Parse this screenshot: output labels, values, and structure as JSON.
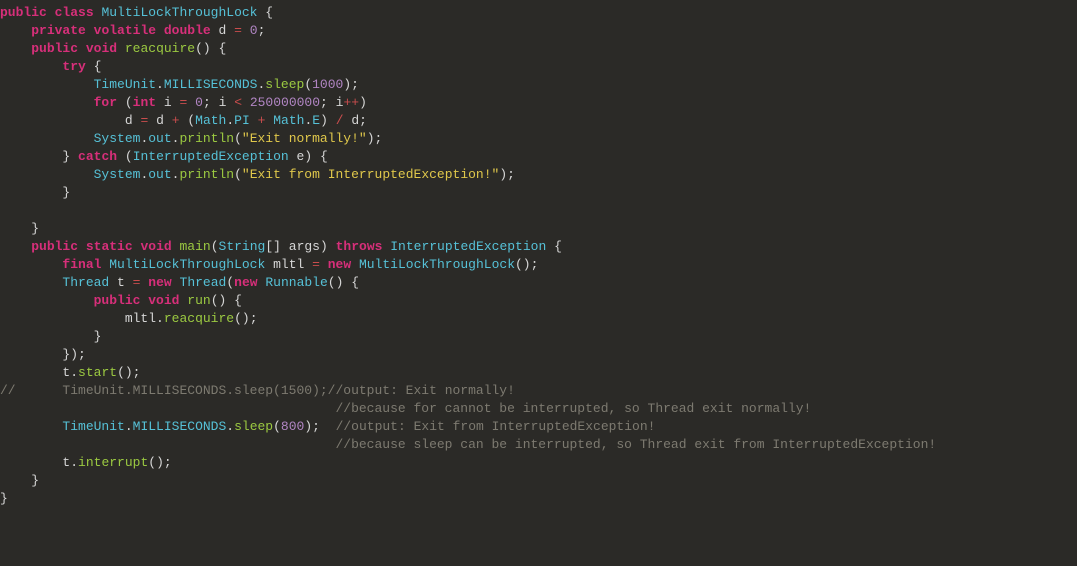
{
  "code": {
    "l1": {
      "public": "public",
      "class": "class",
      "name": "MultiLockThroughLock",
      "ob": "{"
    },
    "l2": {
      "private": "private",
      "volatile": "volatile",
      "type": "double",
      "id": "d",
      "eq": "=",
      "val": "0",
      "sc": ";"
    },
    "l3": {
      "public": "public",
      "void": "void",
      "name": "reacquire",
      "paren": "()",
      "ob": "{"
    },
    "l4": {
      "try": "try",
      "ob": "{"
    },
    "l5": {
      "tu": "TimeUnit",
      "dot1": ".",
      "ms": "MILLISECONDS",
      "dot2": ".",
      "sleep": "sleep",
      "op": "(",
      "arg": "1000",
      "cp": ")",
      "sc": ";"
    },
    "l6": {
      "for": "for",
      "op": "(",
      "int": "int",
      "i": "i",
      "eq": "=",
      "z": "0",
      "sc1": ";",
      "i2": "i",
      "lt": "<",
      "lim": "250000000",
      "sc2": ";",
      "i3": "i",
      "inc": "++",
      "cp": ")"
    },
    "l7": {
      "d1": "d",
      "eq": "=",
      "d2": "d",
      "plus1": "+",
      "op": "(",
      "math1": "Math",
      "dot1": ".",
      "pi": "PI",
      "plus2": "+",
      "math2": "Math",
      "dot2": ".",
      "e": "E",
      "cp": ")",
      "div": "/",
      "d3": "d",
      "sc": ";"
    },
    "l8": {
      "sys": "System",
      "dot1": ".",
      "out": "out",
      "dot2": ".",
      "println": "println",
      "op": "(",
      "str": "\"Exit normally!\"",
      "cp": ")",
      "sc": ";"
    },
    "l9": {
      "cb": "}",
      "catch": "catch",
      "op": "(",
      "type": "InterruptedException",
      "id": "e",
      "cp": ")",
      "ob": "{"
    },
    "l10": {
      "sys": "System",
      "dot1": ".",
      "out": "out",
      "dot2": ".",
      "println": "println",
      "op": "(",
      "str": "\"Exit from InterruptedException!\"",
      "cp": ")",
      "sc": ";"
    },
    "l11": {
      "cb": "}"
    },
    "l12": "",
    "l13": {
      "cb": "}"
    },
    "l14": {
      "public": "public",
      "static": "static",
      "void": "void",
      "main": "main",
      "op": "(",
      "type": "String",
      "br": "[]",
      "args": "args",
      "cp": ")",
      "throws": "throws",
      "exc": "InterruptedException",
      "ob": "{"
    },
    "l15": {
      "final": "final",
      "type": "MultiLockThroughLock",
      "id": "mltl",
      "eq": "=",
      "new": "new",
      "ctor": "MultiLockThroughLock",
      "paren": "()",
      "sc": ";"
    },
    "l16": {
      "type": "Thread",
      "id": "t",
      "eq": "=",
      "new1": "new",
      "thread": "Thread",
      "op": "(",
      "new2": "new",
      "runnable": "Runnable",
      "paren": "()",
      "ob": "{"
    },
    "l17": {
      "public": "public",
      "void": "void",
      "run": "run",
      "paren": "()",
      "ob": "{"
    },
    "l18": {
      "id": "mltl",
      "dot": ".",
      "m": "reacquire",
      "paren": "()",
      "sc": ";"
    },
    "l19": {
      "cb": "}"
    },
    "l20": {
      "cb": "}",
      "cp": ")",
      "sc": ";"
    },
    "l21": {
      "id": "t",
      "dot": ".",
      "m": "start",
      "paren": "()",
      "sc": ";"
    },
    "l22": {
      "cmt": "//",
      "tu": "TimeUnit.MILLISECONDS.sleep(1500);",
      "c": "//output: Exit normally!"
    },
    "l23": {
      "c": "//because for cannot be interrupted, so Thread exit normally!"
    },
    "l24": {
      "tu": "TimeUnit",
      "dot1": ".",
      "ms": "MILLISECONDS",
      "dot2": ".",
      "sleep": "sleep",
      "op": "(",
      "arg": "800",
      "cp": ")",
      "sc": ";",
      "sp": " ",
      "c": "//output: Exit from InterruptedException!"
    },
    "l25": {
      "c": "//because sleep can be interrupted, so Thread exit from InterruptedException!"
    },
    "l26": {
      "id": "t",
      "dot": ".",
      "m": "interrupt",
      "paren": "()",
      "sc": ";"
    },
    "l27": {
      "cb": "}"
    },
    "l28": {
      "cb": "}"
    }
  }
}
